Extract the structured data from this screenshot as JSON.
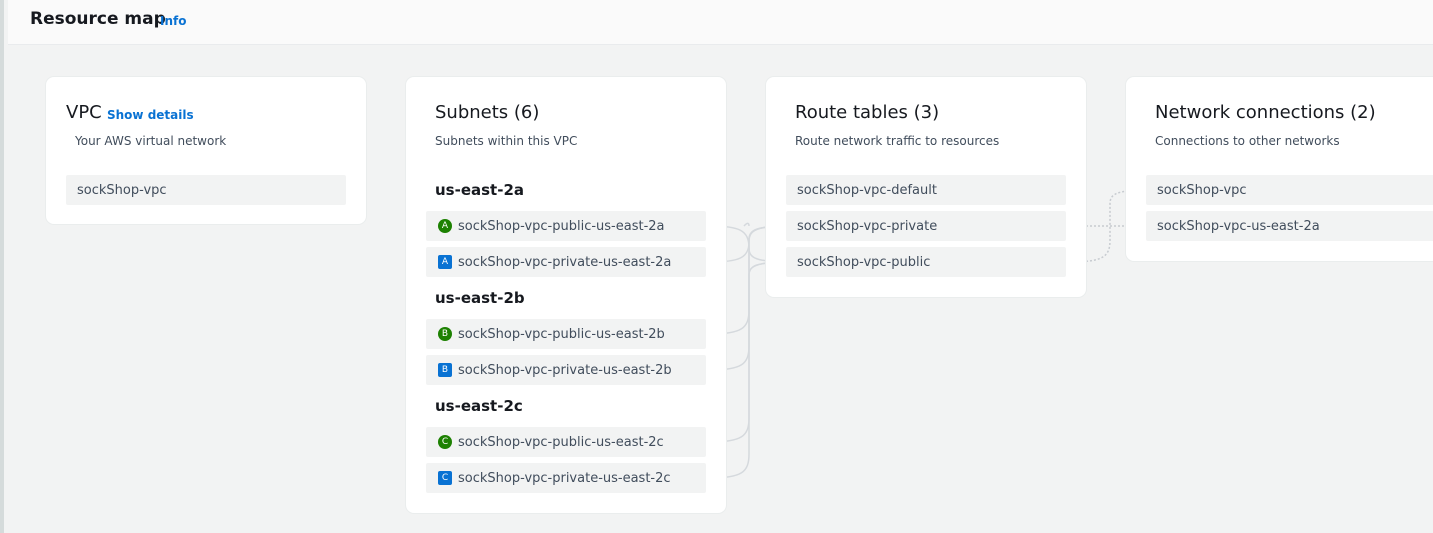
{
  "header": {
    "title": "Resource map",
    "info_label": "Info"
  },
  "vpc": {
    "title": "VPC",
    "show_details_label": "Show details",
    "subtitle": "Your AWS virtual network",
    "item": "sockShop-vpc"
  },
  "subnets": {
    "title": "Subnets (6)",
    "subtitle": "Subnets within this VPC",
    "zones": [
      {
        "name": "us-east-2a",
        "items": [
          {
            "badge": "A",
            "type": "public",
            "label": "sockShop-vpc-public-us-east-2a"
          },
          {
            "badge": "A",
            "type": "private",
            "label": "sockShop-vpc-private-us-east-2a"
          }
        ]
      },
      {
        "name": "us-east-2b",
        "items": [
          {
            "badge": "B",
            "type": "public",
            "label": "sockShop-vpc-public-us-east-2b"
          },
          {
            "badge": "B",
            "type": "private",
            "label": "sockShop-vpc-private-us-east-2b"
          }
        ]
      },
      {
        "name": "us-east-2c",
        "items": [
          {
            "badge": "C",
            "type": "public",
            "label": "sockShop-vpc-public-us-east-2c"
          },
          {
            "badge": "C",
            "type": "private",
            "label": "sockShop-vpc-private-us-east-2c"
          }
        ]
      }
    ]
  },
  "route_tables": {
    "title": "Route tables (3)",
    "subtitle": "Route network traffic to resources",
    "items": [
      "sockShop-vpc-default",
      "sockShop-vpc-private",
      "sockShop-vpc-public"
    ]
  },
  "network_connections": {
    "title": "Network connections (2)",
    "subtitle": "Connections to other networks",
    "items": [
      "sockShop-vpc",
      "sockShop-vpc-us-east-2a"
    ]
  },
  "colors": {
    "public_badge": "#1d8102",
    "private_badge": "#0972d3",
    "link": "#0972d3",
    "connector": "#d1d5db"
  }
}
